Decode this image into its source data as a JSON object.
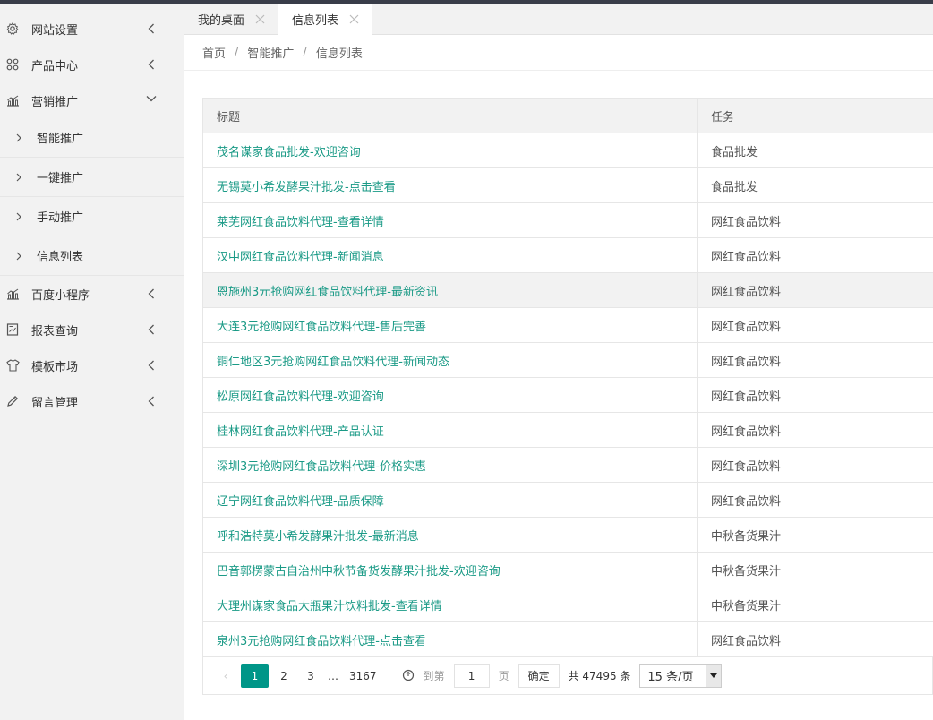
{
  "sidebar": {
    "items": [
      {
        "label": "网站设置",
        "icon": "gear-icon"
      },
      {
        "label": "产品中心",
        "icon": "apps-icon"
      },
      {
        "label": "营销推广",
        "icon": "chart-icon",
        "expanded": true,
        "children": [
          "智能推广",
          "一键推广",
          "手动推广",
          "信息列表"
        ]
      },
      {
        "label": "百度小程序",
        "icon": "chart-icon"
      },
      {
        "label": "报表查询",
        "icon": "report-icon"
      },
      {
        "label": "模板市场",
        "icon": "shirt-icon"
      },
      {
        "label": "留言管理",
        "icon": "pencil-icon"
      }
    ]
  },
  "tabs": [
    {
      "label": "我的桌面",
      "active": false
    },
    {
      "label": "信息列表",
      "active": true
    }
  ],
  "breadcrumb": [
    "首页",
    "智能推广",
    "信息列表"
  ],
  "table": {
    "headers": [
      "标题",
      "任务"
    ],
    "rows": [
      {
        "title": "茂名谋家食品批发-欢迎咨询",
        "task": "食品批发"
      },
      {
        "title": "无锡莫小希发酵果汁批发-点击查看",
        "task": "食品批发"
      },
      {
        "title": "莱芜网红食品饮料代理-查看详情",
        "task": "网红食品饮料"
      },
      {
        "title": "汉中网红食品饮料代理-新闻消息",
        "task": "网红食品饮料"
      },
      {
        "title": "恩施州3元抢购网红食品饮料代理-最新资讯",
        "task": "网红食品饮料"
      },
      {
        "title": "大连3元抢购网红食品饮料代理-售后完善",
        "task": "网红食品饮料"
      },
      {
        "title": "铜仁地区3元抢购网红食品饮料代理-新闻动态",
        "task": "网红食品饮料"
      },
      {
        "title": "松原网红食品饮料代理-欢迎咨询",
        "task": "网红食品饮料"
      },
      {
        "title": "桂林网红食品饮料代理-产品认证",
        "task": "网红食品饮料"
      },
      {
        "title": "深圳3元抢购网红食品饮料代理-价格实惠",
        "task": "网红食品饮料"
      },
      {
        "title": "辽宁网红食品饮料代理-品质保障",
        "task": "网红食品饮料"
      },
      {
        "title": "呼和浩特莫小希发酵果汁批发-最新消息",
        "task": "中秋备货果汁"
      },
      {
        "title": "巴音郭楞蒙古自治州中秋节备货发酵果汁批发-欢迎咨询",
        "task": "中秋备货果汁"
      },
      {
        "title": "大理州谋家食品大瓶果汁饮料批发-查看详情",
        "task": "中秋备货果汁"
      },
      {
        "title": "泉州3元抢购网红食品饮料代理-点击查看",
        "task": "网红食品饮料"
      }
    ]
  },
  "pager": {
    "prev": "‹",
    "pages": [
      "1",
      "2",
      "3"
    ],
    "ellipsis": "…",
    "last": "3167",
    "current": "1",
    "goto_label": "到第",
    "goto_value": "1",
    "page_unit": "页",
    "ok_label": "确定",
    "total_label": "共 47495 条",
    "page_size": "15 条/页"
  },
  "colors": {
    "accent": "#009688",
    "link": "#1a9a86"
  }
}
